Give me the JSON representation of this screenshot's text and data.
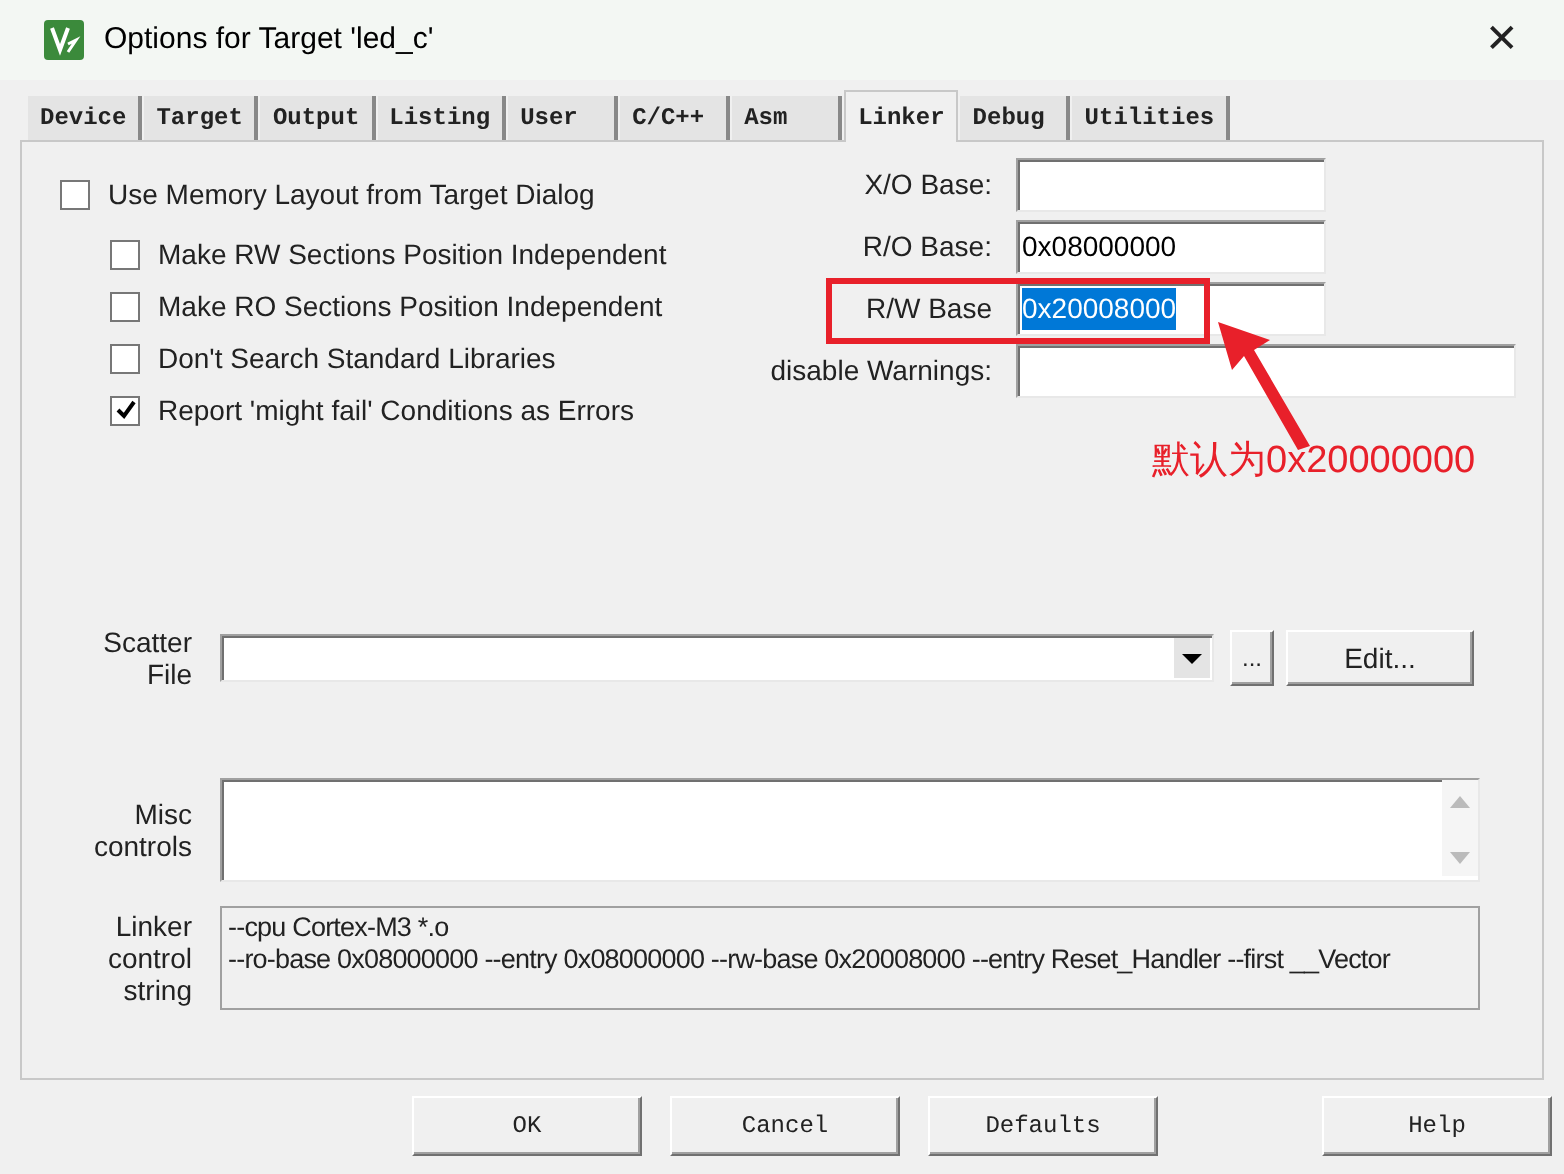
{
  "window": {
    "title": "Options for Target 'led_c'",
    "close": "✕"
  },
  "tabs": [
    {
      "label": "Device",
      "selected": false
    },
    {
      "label": "Target",
      "selected": false
    },
    {
      "label": "Output",
      "selected": false
    },
    {
      "label": "Listing",
      "selected": false
    },
    {
      "label": "User",
      "selected": false
    },
    {
      "label": "C/C++",
      "selected": false
    },
    {
      "label": "Asm",
      "selected": false
    },
    {
      "label": "Linker",
      "selected": true
    },
    {
      "label": "Debug",
      "selected": false
    },
    {
      "label": "Utilities",
      "selected": false
    }
  ],
  "options": [
    {
      "label": "Use Memory Layout from Target Dialog",
      "checked": false,
      "children": [
        {
          "label": "Make RW Sections Position Independent",
          "checked": false
        },
        {
          "label": "Make RO Sections Position Independent",
          "checked": false
        },
        {
          "label": "Don't Search Standard Libraries",
          "checked": false
        },
        {
          "label": "Report 'might fail' Conditions as Errors",
          "checked": true
        }
      ]
    }
  ],
  "fields": [
    {
      "label": "X/O Base:"
    },
    {
      "label": "R/O Base:",
      "value": "0x08000000",
      "highlighted": false
    },
    {
      "label": "R/W Base",
      "value": "0x20008000",
      "highlighted": true
    },
    {
      "label": "disable Warnings:",
      "kind": "wide"
    }
  ],
  "annotation": {
    "text": "默认为0x20000000"
  },
  "scatter": {
    "label": "Scatter File",
    "browse": "...",
    "edit": "Edit..."
  },
  "misc": {
    "label": "Misc controls"
  },
  "linker": {
    "label": "Linker control string",
    "lines": [
      "--cpu Cortex-M3 *.o",
      "--ro-base 0x08000000 --entry 0x08000000 --rw-base 0x20008000 --entry Reset_Handler --first __Vector"
    ]
  },
  "buttons": [
    {
      "label": "OK"
    },
    {
      "label": "Cancel"
    },
    {
      "label": "Defaults"
    },
    {
      "label": "Help"
    }
  ]
}
